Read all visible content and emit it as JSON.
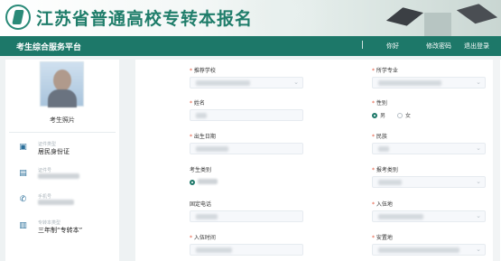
{
  "banner": {
    "title": "江苏省普通高校专转本报名"
  },
  "nav": {
    "title": "考生综合服务平台",
    "separator": "|",
    "links": [
      "你好",
      "修改密码",
      "退出登录"
    ]
  },
  "profile": {
    "photo_caption": "考生照片",
    "items": [
      {
        "icon": "id-card-icon",
        "glyph": "▣",
        "label": "证件类型",
        "value": "居民身份证"
      },
      {
        "icon": "document-icon",
        "glyph": "▤",
        "label": "证件号",
        "value": ""
      },
      {
        "icon": "phone-icon",
        "glyph": "✆",
        "label": "手机号",
        "value": ""
      },
      {
        "icon": "book-icon",
        "glyph": "▥",
        "label": "专转本类型",
        "value": "三年制“专转本”"
      }
    ]
  },
  "form": {
    "required_mark": "*",
    "fields": {
      "recommend_school": "推荐学校",
      "major": "所学专业",
      "name": "姓名",
      "gender": "性别",
      "birth_date": "出生日期",
      "ethnicity": "民族",
      "candidate_type": "考生类别",
      "apply_type": "报考类别",
      "landline": "固定电话",
      "enroll_place": "入伍地",
      "enroll_time": "入伍时间",
      "settle_place": "安置地"
    },
    "gender_options": [
      "男",
      "女"
    ],
    "gender_selected": "男"
  },
  "colors": {
    "primary": "#1d7869",
    "title": "#1f7d6a",
    "required": "#e3553b"
  }
}
